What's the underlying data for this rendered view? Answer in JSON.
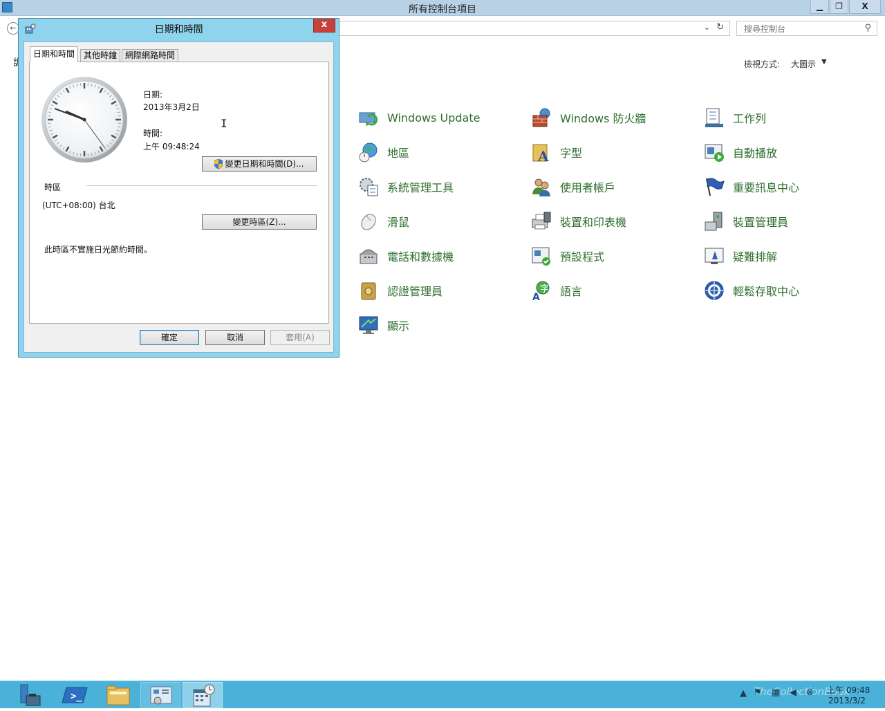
{
  "control_panel": {
    "title": "所有控制台項目",
    "search_placeholder": "搜尋控制台",
    "view_by_label": "檢視方式:",
    "view_by_value": "大圖示",
    "left_edge_text": "調",
    "items": [
      {
        "label": "Windows Update",
        "icon": "windows-update-icon"
      },
      {
        "label": "Windows 防火牆",
        "icon": "firewall-icon"
      },
      {
        "label": "工作列",
        "icon": "taskbar-icon"
      },
      {
        "label": "地區",
        "icon": "region-icon"
      },
      {
        "label": "字型",
        "icon": "fonts-icon"
      },
      {
        "label": "自動播放",
        "icon": "autoplay-icon"
      },
      {
        "label": "系統管理工具",
        "icon": "admin-tools-icon"
      },
      {
        "label": "使用者帳戶",
        "icon": "user-accounts-icon"
      },
      {
        "label": "重要訊息中心",
        "icon": "action-center-icon"
      },
      {
        "label": "滑鼠",
        "icon": "mouse-icon"
      },
      {
        "label": "裝置和印表機",
        "icon": "printer-icon"
      },
      {
        "label": "裝置管理員",
        "icon": "device-manager-icon"
      },
      {
        "label": "電話和數據機",
        "icon": "phone-modem-icon"
      },
      {
        "label": "預設程式",
        "icon": "default-programs-icon"
      },
      {
        "label": "疑難排解",
        "icon": "troubleshooting-icon"
      },
      {
        "label": "認證管理員",
        "icon": "credential-manager-icon"
      },
      {
        "label": "語言",
        "icon": "language-icon"
      },
      {
        "label": "輕鬆存取中心",
        "icon": "ease-of-access-icon"
      },
      {
        "label": "顯示",
        "icon": "display-icon"
      }
    ]
  },
  "dialog": {
    "title": "日期和時間",
    "close_symbol": "x",
    "tabs": [
      "日期和時間",
      "其他時鐘",
      "網際網路時間"
    ],
    "date_label": "日期:",
    "date_value": "2013年3月2日",
    "time_label": "時間:",
    "time_value": "上午 09:48:24",
    "clock": {
      "hour": 9,
      "minute": 48,
      "second": 24
    },
    "change_datetime_button": "變更日期和時間(D)...",
    "timezone_group_label": "時區",
    "timezone_value": "(UTC+08:00) 台北",
    "change_timezone_button": "變更時區(Z)...",
    "dst_note": "此時區不實施日光節約時間。",
    "ok_button": "確定",
    "cancel_button": "取消",
    "apply_button": "套用(A)"
  },
  "window_buttons": {
    "minimize": "▁",
    "restore": "❐",
    "close": "X"
  },
  "taskbar": {
    "clock_time": "上午 09:48",
    "clock_date": "2013/3/2",
    "watermark": "TheCollectionBook"
  },
  "colors": {
    "item_label": "#2e6e2e",
    "dialog_frame": "#8fd3ec",
    "taskbar": "#4ab1d8",
    "close_red": "#c7423a"
  }
}
